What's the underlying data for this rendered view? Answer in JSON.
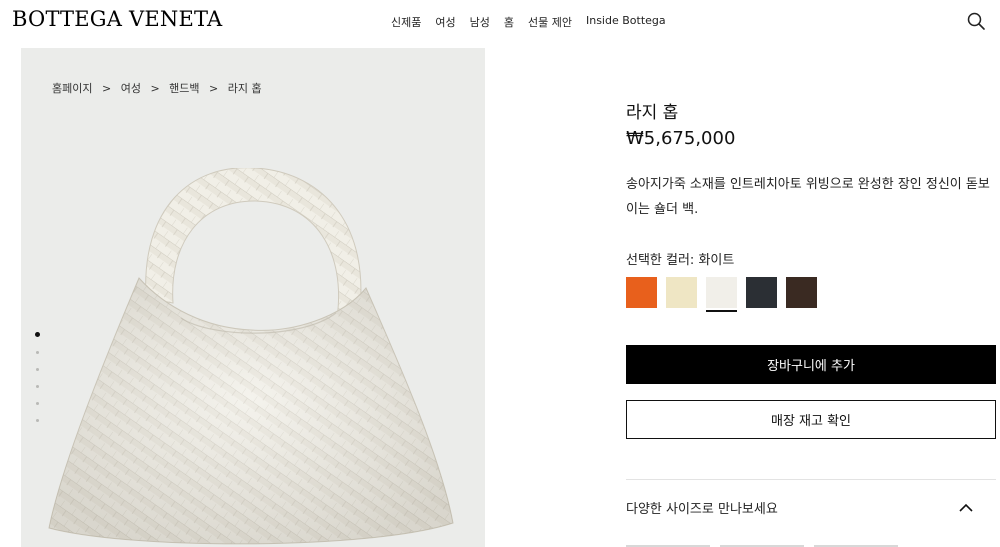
{
  "header": {
    "logo": "BOTTEGA VENETA",
    "nav": [
      "신제품",
      "여성",
      "남성",
      "홈",
      "선물 제안",
      "Inside Bottega"
    ],
    "search_icon": "search-icon"
  },
  "breadcrumb": [
    "홈페이지",
    ">",
    "여성",
    ">",
    "핸드백",
    ">",
    "라지 홉"
  ],
  "gallery": {
    "image": "woven-leather-hobo-bag-white",
    "slide_count": 6,
    "active_slide": 1
  },
  "product": {
    "name": "라지 홉",
    "price": "₩5,675,000",
    "description": "송아지가죽 소재를 인트레치아토 위빙으로 완성한 장인 정신이 돋보이는 숄더 백.",
    "color_label": "선택한 컬러: 화이트",
    "colors": [
      "#e8601c",
      "#efe6c4",
      "#f1efe9",
      "#2b2f34",
      "#3a2a22"
    ],
    "selected_color_index": 2,
    "add_to_cart": "장바구니에 추가",
    "check_stock": "매장 재고 확인",
    "sizes_toggle": "다양한 사이즈로 만나보세요",
    "chevron_icon": "chevron-up-icon"
  }
}
